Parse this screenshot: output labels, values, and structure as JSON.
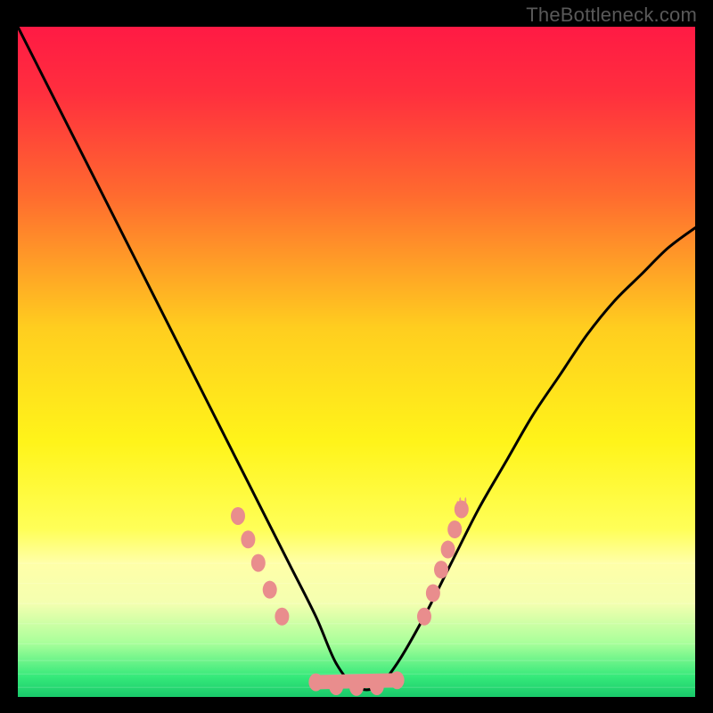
{
  "watermark": "TheBottleneck.com",
  "chart_data": {
    "type": "line",
    "title": "",
    "xlabel": "",
    "ylabel": "",
    "xlim": [
      0,
      100
    ],
    "ylim": [
      0,
      100
    ],
    "background_gradient": {
      "stops": [
        {
          "offset": 0.0,
          "color": "#ff1a44"
        },
        {
          "offset": 0.1,
          "color": "#ff2f3e"
        },
        {
          "offset": 0.25,
          "color": "#ff6a2f"
        },
        {
          "offset": 0.45,
          "color": "#ffce1f"
        },
        {
          "offset": 0.62,
          "color": "#fff41a"
        },
        {
          "offset": 0.75,
          "color": "#ffff58"
        },
        {
          "offset": 0.8,
          "color": "#ffffa8"
        },
        {
          "offset": 0.86,
          "color": "#f4ffb0"
        },
        {
          "offset": 0.92,
          "color": "#a8ff9a"
        },
        {
          "offset": 0.97,
          "color": "#35e97a"
        },
        {
          "offset": 1.0,
          "color": "#19c96a"
        }
      ]
    },
    "series": [
      {
        "name": "bottleneck-curve",
        "x": [
          0,
          4,
          8,
          12,
          16,
          20,
          24,
          28,
          32,
          36,
          40,
          44,
          47,
          50,
          53,
          56,
          60,
          64,
          68,
          72,
          76,
          80,
          84,
          88,
          92,
          96,
          100
        ],
        "y": [
          100,
          92,
          84,
          76,
          68,
          60,
          52,
          44,
          36,
          28,
          20,
          12,
          5,
          1.5,
          1.5,
          5,
          12,
          20,
          28,
          35,
          42,
          48,
          54,
          59,
          63,
          67,
          70
        ]
      }
    ],
    "markers": {
      "color": "#e98d8d",
      "left_arm": [
        {
          "x": 32.5,
          "y": 27
        },
        {
          "x": 34,
          "y": 23.5
        },
        {
          "x": 35.5,
          "y": 20
        },
        {
          "x": 37.2,
          "y": 16
        },
        {
          "x": 39,
          "y": 12
        }
      ],
      "right_arm": [
        {
          "x": 60,
          "y": 12
        },
        {
          "x": 61.3,
          "y": 15.5
        },
        {
          "x": 62.5,
          "y": 19
        },
        {
          "x": 63.5,
          "y": 22
        },
        {
          "x": 64.5,
          "y": 25
        },
        {
          "x": 65.5,
          "y": 28
        }
      ],
      "bottom": [
        {
          "x": 44,
          "y": 2.2
        },
        {
          "x": 47,
          "y": 1.6
        },
        {
          "x": 50,
          "y": 1.5
        },
        {
          "x": 53,
          "y": 1.6
        },
        {
          "x": 56,
          "y": 2.5
        }
      ]
    }
  }
}
